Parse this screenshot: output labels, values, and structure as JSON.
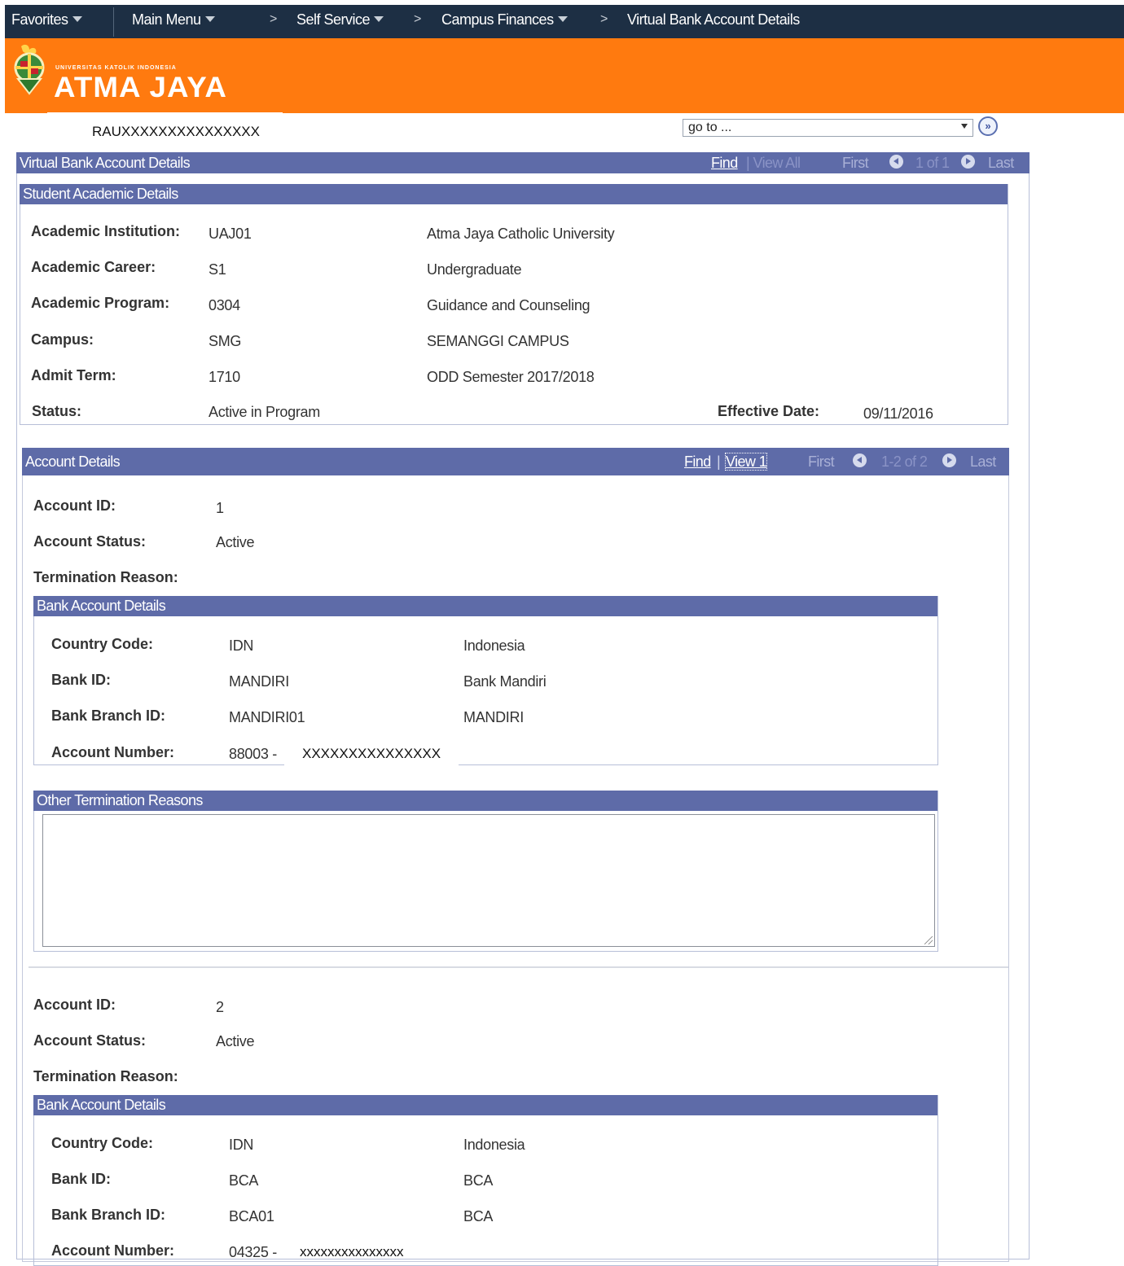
{
  "nav": {
    "favorites": "Favorites",
    "main_menu": "Main Menu",
    "self_service": "Self Service",
    "campus_finances": "Campus Finances",
    "current_page": "Virtual Bank Account Details",
    "sep": ">"
  },
  "logo": {
    "university_small": "UNIVERSITAS KATOLIK INDONESIA",
    "university_name": "ATMA JAYA"
  },
  "user_id": "RAUXXXXXXXXXXXXXXX",
  "goto": {
    "placeholder": "go to ...",
    "go_label": "»"
  },
  "main": {
    "title": "Virtual Bank Account Details",
    "find": "Find",
    "view_all": "View All",
    "first": "First",
    "range": "1 of 1",
    "last": "Last"
  },
  "academic": {
    "title": "Student Academic Details",
    "rows": [
      {
        "label": "Academic Institution:",
        "code": "UAJ01",
        "desc": "Atma Jaya Catholic University"
      },
      {
        "label": "Academic Career:",
        "code": "S1",
        "desc": "Undergraduate"
      },
      {
        "label": "Academic Program:",
        "code": "0304",
        "desc": "Guidance and Counseling"
      },
      {
        "label": "Campus:",
        "code": "SMG",
        "desc": "SEMANGGI CAMPUS"
      },
      {
        "label": "Admit Term:",
        "code": "1710",
        "desc": "ODD Semester 2017/2018"
      }
    ],
    "status_label": "Status:",
    "status_value": "Active in Program",
    "effective_label": "Effective Date:",
    "effective_value": "09/11/2016"
  },
  "accounts_section": {
    "title": "Account Details",
    "find": "Find",
    "view": "View 1",
    "first": "First",
    "range": "1-2 of 2",
    "last": "Last"
  },
  "accounts": [
    {
      "id_label": "Account ID:",
      "id": "1",
      "status_label": "Account Status:",
      "status": "Active",
      "termination_label": "Termination Reason:",
      "bank": {
        "title": "Bank Account Details",
        "country_label": "Country Code:",
        "country_code": "IDN",
        "country_name": "Indonesia",
        "bank_label": "Bank ID:",
        "bank_id": "MANDIRI",
        "bank_name": "Bank Mandiri",
        "branch_label": "Bank Branch ID:",
        "branch_id": "MANDIRI01",
        "branch_name": "MANDIRI",
        "acct_label": "Account Number:",
        "acct_prefix": "88003 -",
        "acct_masked": "XXXXXXXXXXXXXXX"
      },
      "other_termination_title": "Other Termination Reasons",
      "other_termination_text": ""
    },
    {
      "id_label": "Account ID:",
      "id": "2",
      "status_label": "Account Status:",
      "status": "Active",
      "termination_label": "Termination Reason:",
      "bank": {
        "title": "Bank Account Details",
        "country_label": "Country Code:",
        "country_code": "IDN",
        "country_name": "Indonesia",
        "bank_label": "Bank ID:",
        "bank_id": "BCA",
        "bank_name": "BCA",
        "branch_label": "Bank Branch ID:",
        "branch_id": "BCA01",
        "branch_name": "BCA",
        "acct_label": "Account Number:",
        "acct_prefix": "04325 -",
        "acct_masked": "xxxxxxxxxxxxxxx"
      }
    }
  ]
}
